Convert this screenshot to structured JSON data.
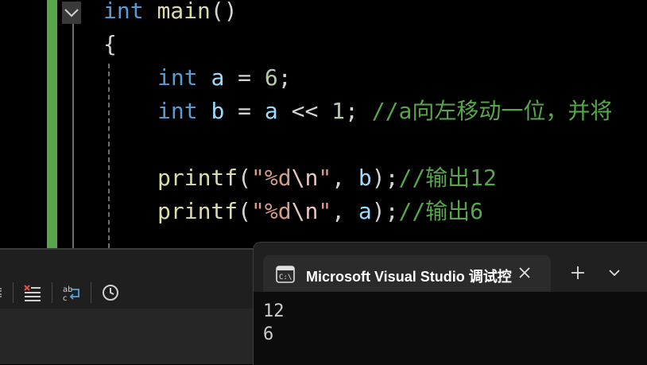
{
  "editor": {
    "line1": {
      "kw": "int",
      "name": "main",
      "paren": "()"
    },
    "line2": {
      "brace": "{"
    },
    "line3": {
      "kw": "int",
      "var": "a",
      "eq": " = ",
      "num": "6",
      "semi": ";"
    },
    "line4": {
      "kw": "int",
      "var": "b",
      "eq": " = ",
      "var2": "a",
      "shift": " << ",
      "num": "1",
      "semi": "; ",
      "comment": "//a向左移动一位，并将"
    },
    "line5": {
      "fn": "printf",
      "open": "(",
      "q1": "\"",
      "fmt": "%d",
      "esc": "\\n",
      "q2": "\"",
      "comma": ", ",
      "var": "b",
      "close": ");",
      "comment": "//输出12"
    },
    "line6": {
      "fn": "printf",
      "open": "(",
      "q1": "\"",
      "fmt": "%d",
      "esc": "\\n",
      "q2": "\"",
      "comma": ", ",
      "var": "a",
      "close": ");",
      "comment": "//输出6"
    }
  },
  "console": {
    "tab_title": "Microsoft Visual Studio 调试控",
    "output": [
      "12",
      "6"
    ]
  },
  "colors": {
    "keyword": "#569cd6",
    "function": "#dcdcaa",
    "variable": "#9cdcfe",
    "number": "#b5cea8",
    "string": "#d69d85",
    "comment": "#57a64a",
    "change_bar": "#57a64a"
  },
  "icons": [
    "collapse-chevron-icon",
    "clear-all-icon",
    "word-wrap-icon",
    "clock-icon",
    "terminal-icon",
    "close-icon",
    "plus-icon",
    "chevron-down-icon"
  ]
}
